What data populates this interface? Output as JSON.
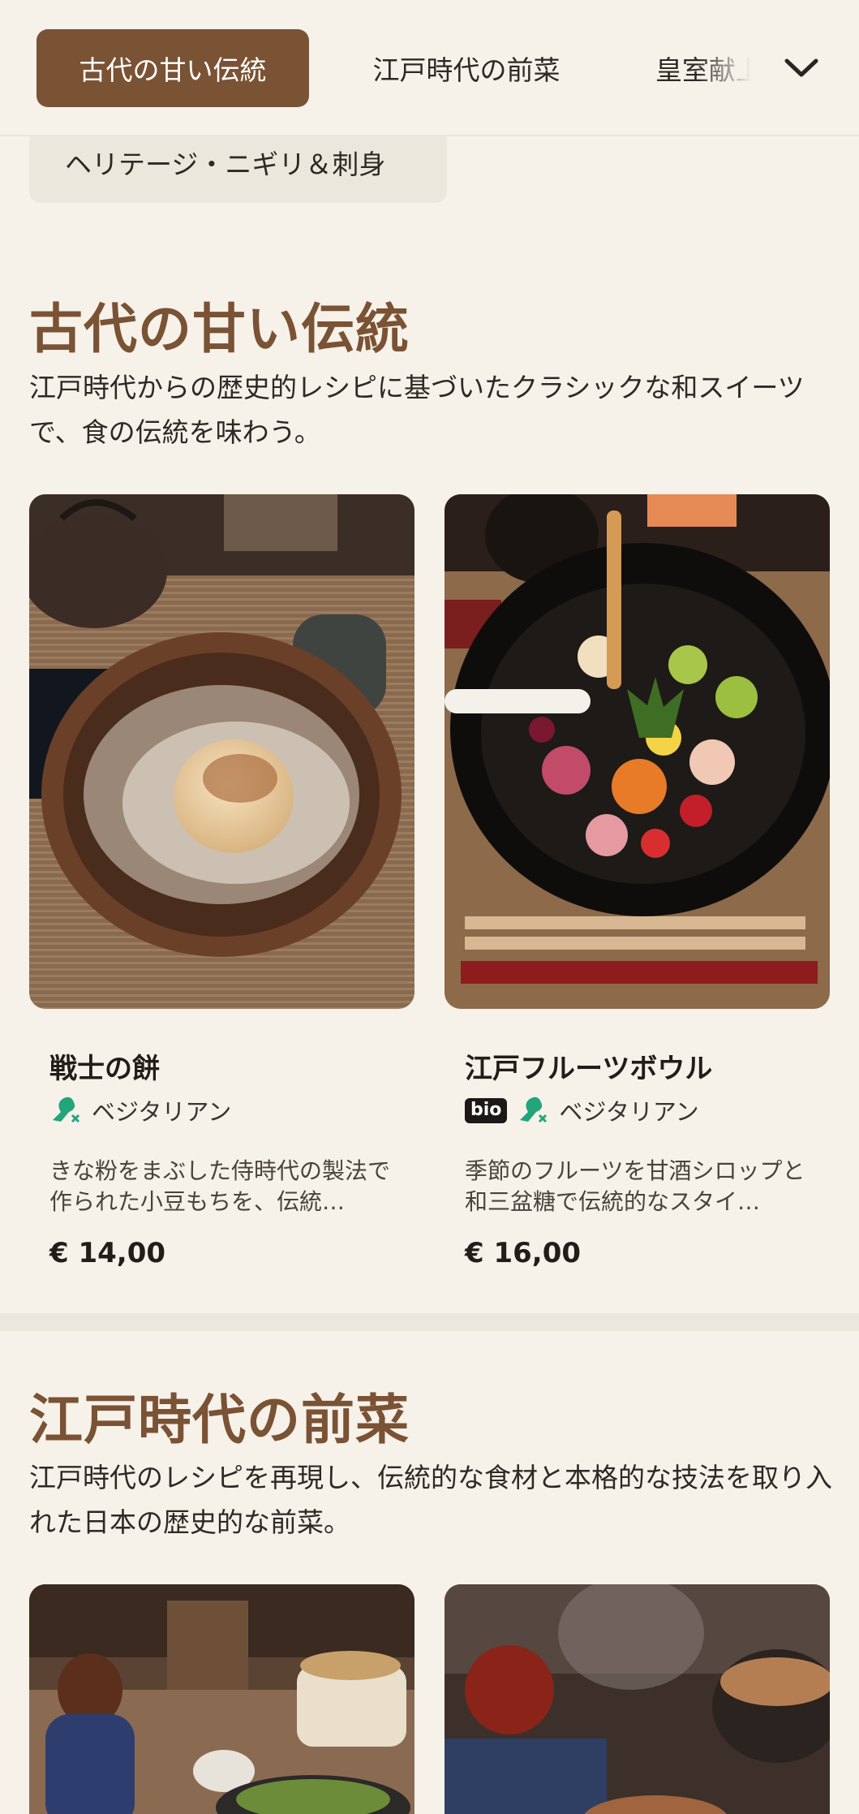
{
  "nav": {
    "tabs": [
      {
        "label": "古代の甘い伝統"
      },
      {
        "label": "江戸時代の前菜"
      },
      {
        "label": "皇室献上"
      }
    ],
    "chip_label": "ヘリテージ・ニギリ＆刺身"
  },
  "sections": [
    {
      "title": "古代の甘い伝統",
      "description": "江戸時代からの歴史的レシピに基づいたクラシックな和スイーツで、食の伝統を味わう。",
      "items": [
        {
          "name": "戦士の餅",
          "badge": "",
          "diet": "ベジタリアン",
          "description": "きな粉をまぶした侍時代の製法で作られた小豆もちを、伝統…",
          "price": "€ 14,00"
        },
        {
          "name": "江戸フルーツボウル",
          "badge": "bio",
          "diet": "ベジタリアン",
          "description": "季節のフルーツを甘酒シロップと和三盆糖で伝統的なスタイ…",
          "price": "€ 16,00"
        }
      ]
    },
    {
      "title": "江戸時代の前菜",
      "description": "江戸時代のレシピを再現し、伝統的な食材と本格的な技法を取り入れた日本の歴史的な前菜。"
    }
  ],
  "icons": {
    "expand": "chevron-down-icon",
    "diet": "vegetarian-leg-icon"
  },
  "colors": {
    "accent": "#7a5234",
    "background": "#f6f2ea",
    "veg_green": "#22a57a"
  }
}
